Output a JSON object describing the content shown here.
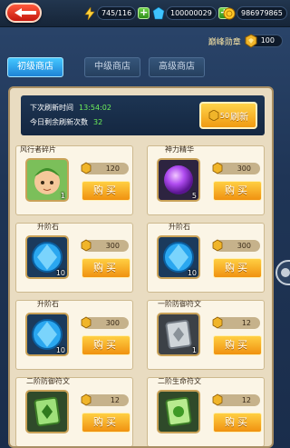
{
  "topbar": {
    "stamina": "745/116",
    "crystal": "100000029",
    "gold": "986979865"
  },
  "header": {
    "badge_label": "巅峰勋章",
    "badge_value": "100"
  },
  "tabs": [
    {
      "label": "初级商店",
      "active": true
    },
    {
      "label": "中级商店",
      "active": false
    },
    {
      "label": "高级商店",
      "active": false
    }
  ],
  "info": {
    "next_refresh_label": "下次刷新时间",
    "next_refresh_value": "13:54:02",
    "remaining_label": "今日剩余刷新次数",
    "remaining_value": "32",
    "refresh_cost": "50",
    "refresh_label": "刷新"
  },
  "buy_label": "购买",
  "items": [
    {
      "name": "风行者碎片",
      "price": "120",
      "qty": "1",
      "icon": "hero-portrait-icon"
    },
    {
      "name": "神力精华",
      "price": "300",
      "qty": "5",
      "icon": "purple-orb-icon"
    },
    {
      "name": "升阶石",
      "price": "300",
      "qty": "10",
      "icon": "blue-gem-icon"
    },
    {
      "name": "升阶石",
      "price": "300",
      "qty": "10",
      "icon": "blue-gem-icon"
    },
    {
      "name": "升阶石",
      "price": "300",
      "qty": "10",
      "icon": "blue-gem-icon"
    },
    {
      "name": "一阶防御符文",
      "price": "12",
      "qty": "1",
      "icon": "grey-rune-icon"
    },
    {
      "name": "二阶防御符文",
      "price": "12",
      "qty": "",
      "icon": "green-rune-icon"
    },
    {
      "name": "二阶生命符文",
      "price": "12",
      "qty": "",
      "icon": "green-life-rune-icon"
    }
  ],
  "colors": {
    "accent_tab": "#1e83d6",
    "buy_button": "#f09110",
    "panel": "#e9dcc1",
    "timer_text": "#6ef05a"
  }
}
